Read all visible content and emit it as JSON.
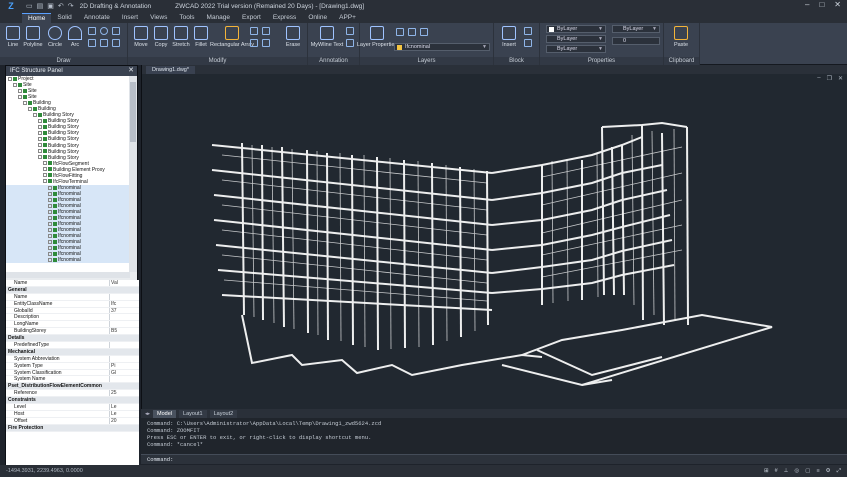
{
  "title_bar": {
    "workspace": "2D Drafting & Annotation",
    "window_title": "ZWCAD 2022 Trial version (Remained 20 Days) - [Drawing1.dwg]"
  },
  "ribbon_tabs": [
    "Home",
    "Solid",
    "Annotate",
    "Insert",
    "Views",
    "Tools",
    "Manage",
    "Export",
    "Express",
    "Online",
    "APP+"
  ],
  "ribbon": {
    "draw": {
      "label": "Draw",
      "tools": [
        "Line",
        "Polyline",
        "Circle",
        "Arc"
      ]
    },
    "modify": {
      "label": "Modify",
      "tools": [
        "Move",
        "Copy",
        "Stretch",
        "Fillet",
        "Rectangular Array",
        "Erase"
      ]
    },
    "annotation": {
      "label": "Annotation",
      "tools": [
        "MyWline Text"
      ]
    },
    "layers": {
      "label": "Layers",
      "tools": [
        "Layer Properties"
      ],
      "current_layer": "Ifcnominal"
    },
    "block": {
      "label": "Block",
      "tools": [
        "Insert"
      ]
    },
    "properties": {
      "label": "Properties",
      "color": "ByLayer",
      "linetype": "ByLayer",
      "lineweight": "ByLayer",
      "plotstyle": "ByLayer",
      "transparency": "0"
    },
    "clipboard": {
      "label": "Clipboard",
      "tools": [
        "Paste"
      ]
    }
  },
  "ifc_panel": {
    "title": "IFC Structure Panel",
    "tree": [
      {
        "indent": 0,
        "label": "Project"
      },
      {
        "indent": 1,
        "label": "Site"
      },
      {
        "indent": 2,
        "label": "Site"
      },
      {
        "indent": 2,
        "label": "Site"
      },
      {
        "indent": 3,
        "label": "Building"
      },
      {
        "indent": 4,
        "label": "Building"
      },
      {
        "indent": 5,
        "label": "Building Story"
      },
      {
        "indent": 6,
        "label": "Building Story"
      },
      {
        "indent": 6,
        "label": "Building Story"
      },
      {
        "indent": 6,
        "label": "Building Story"
      },
      {
        "indent": 6,
        "label": "Building Story"
      },
      {
        "indent": 6,
        "label": "Building Story"
      },
      {
        "indent": 6,
        "label": "Building Story"
      },
      {
        "indent": 6,
        "label": "Building Story"
      },
      {
        "indent": 7,
        "label": "IfcFlowSegment"
      },
      {
        "indent": 7,
        "label": "Building Element Proxy"
      },
      {
        "indent": 7,
        "label": "IfcFlowFitting"
      },
      {
        "indent": 7,
        "label": "IfcFlowTerminal"
      },
      {
        "indent": 8,
        "label": "Ifcnominal"
      },
      {
        "indent": 8,
        "label": "Ifcnominal"
      },
      {
        "indent": 8,
        "label": "Ifcnominal"
      },
      {
        "indent": 8,
        "label": "Ifcnominal"
      },
      {
        "indent": 8,
        "label": "Ifcnominal"
      },
      {
        "indent": 8,
        "label": "Ifcnominal"
      },
      {
        "indent": 8,
        "label": "Ifcnominal"
      },
      {
        "indent": 8,
        "label": "Ifcnominal"
      },
      {
        "indent": 8,
        "label": "Ifcnominal"
      },
      {
        "indent": 8,
        "label": "Ifcnominal"
      },
      {
        "indent": 8,
        "label": "Ifcnominal"
      },
      {
        "indent": 8,
        "label": "Ifcnominal"
      },
      {
        "indent": 8,
        "label": "Ifcnominal"
      }
    ],
    "properties": [
      {
        "cat": false,
        "name": "Name",
        "value": "Val"
      },
      {
        "cat": true,
        "name": "General",
        "value": ""
      },
      {
        "cat": false,
        "name": "Name",
        "value": ""
      },
      {
        "cat": false,
        "name": "EntityClassName",
        "value": "Ifc"
      },
      {
        "cat": false,
        "name": "GlobalId",
        "value": "37"
      },
      {
        "cat": false,
        "name": "Description",
        "value": ""
      },
      {
        "cat": false,
        "name": "LongName",
        "value": ""
      },
      {
        "cat": false,
        "name": "BuildingStorey",
        "value": "B5"
      },
      {
        "cat": true,
        "name": "Details",
        "value": ""
      },
      {
        "cat": false,
        "name": "PredefinedType",
        "value": ""
      },
      {
        "cat": true,
        "name": "Mechanical",
        "value": ""
      },
      {
        "cat": false,
        "name": "System Abbreviation",
        "value": ""
      },
      {
        "cat": false,
        "name": "System Type",
        "value": "Pi"
      },
      {
        "cat": false,
        "name": "System Classification",
        "value": "Gl"
      },
      {
        "cat": false,
        "name": "System Name",
        "value": ""
      },
      {
        "cat": true,
        "name": "Pset_DistributionFlowElementCommon",
        "value": ""
      },
      {
        "cat": false,
        "name": "Reference",
        "value": "25"
      },
      {
        "cat": true,
        "name": "Constraints",
        "value": ""
      },
      {
        "cat": false,
        "name": "Level",
        "value": "Le"
      },
      {
        "cat": false,
        "name": "Host",
        "value": "Le"
      },
      {
        "cat": false,
        "name": "Offset",
        "value": "20"
      },
      {
        "cat": true,
        "name": "Fire Protection",
        "value": ""
      }
    ]
  },
  "canvas": {
    "doc_tab": "Drawing1.dwg*"
  },
  "layout_tabs": [
    "Model",
    "Layout1",
    "Layout2"
  ],
  "command_history": [
    "Command: C:\\Users\\Administrator\\AppData\\Local\\Temp\\Drawing1_zwd5624.zcd",
    "Command: ZOOMFIT",
    "Press ESC or ENTER to exit, or right-click to display shortcut menu.",
    "Command: *cancel*"
  ],
  "command_prompt": "Command:",
  "status_bar": {
    "coordinates": "-1494.3931, 2239.4963, 0.0000"
  }
}
